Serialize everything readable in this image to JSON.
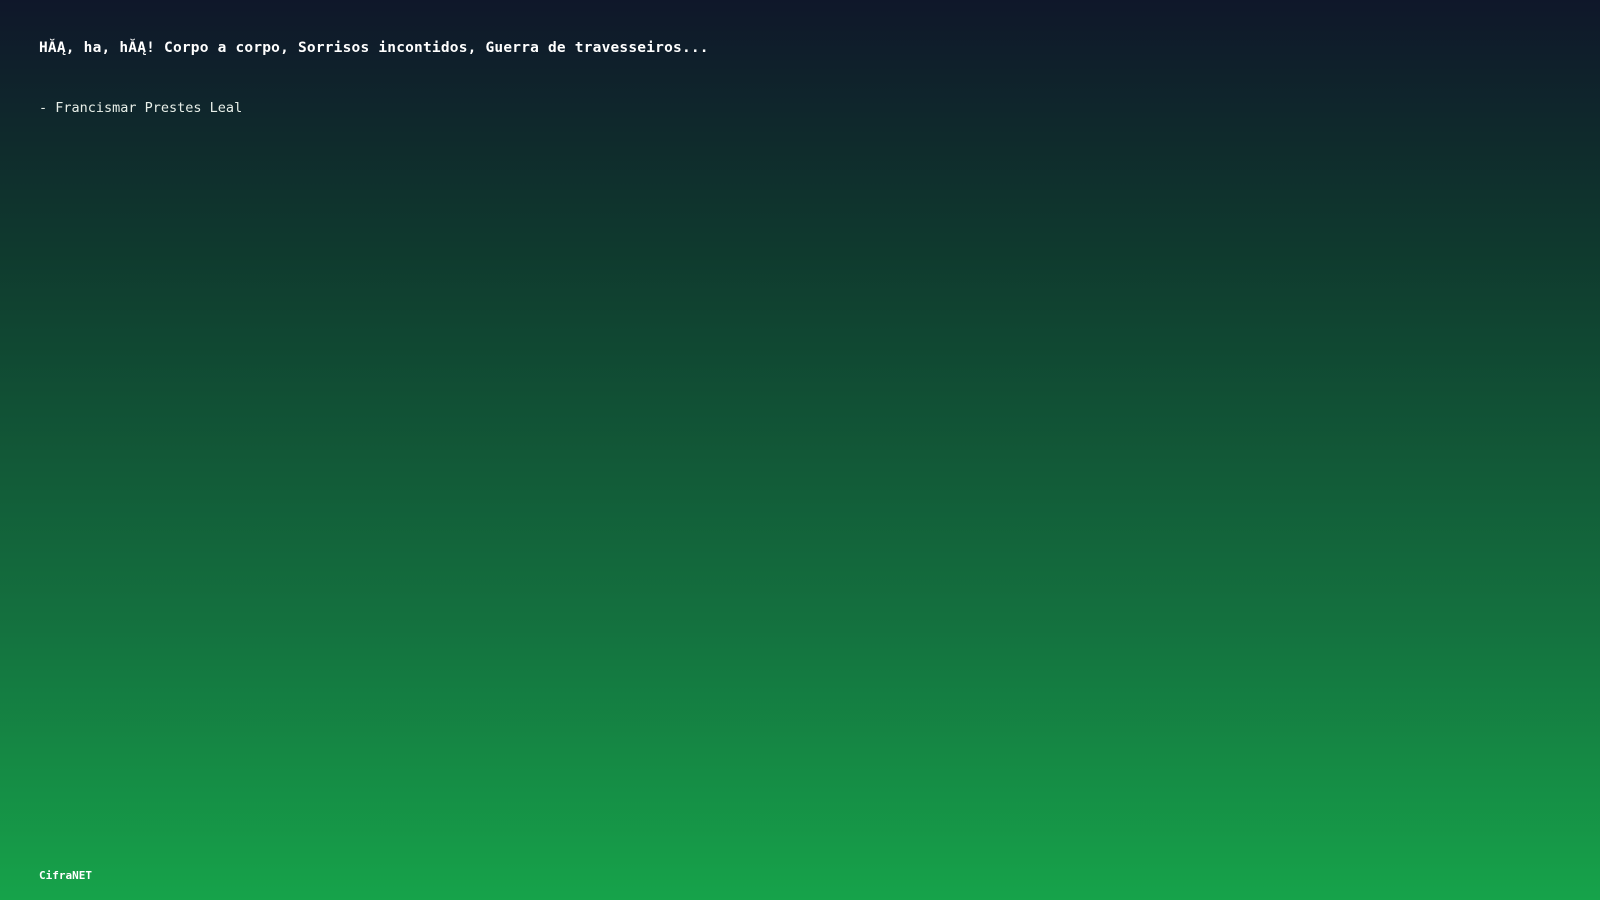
{
  "quote": {
    "text": "HĂĄ, ha, hĂĄ! Corpo a corpo, Sorrisos incontidos, Guerra de travesseiros...",
    "author": "- Francismar Prestes Leal"
  },
  "footer": {
    "brand": "CifraNET"
  },
  "colors": {
    "background_top": "#0f172a",
    "background_bottom": "#16a34a",
    "text": "#ffffff"
  }
}
